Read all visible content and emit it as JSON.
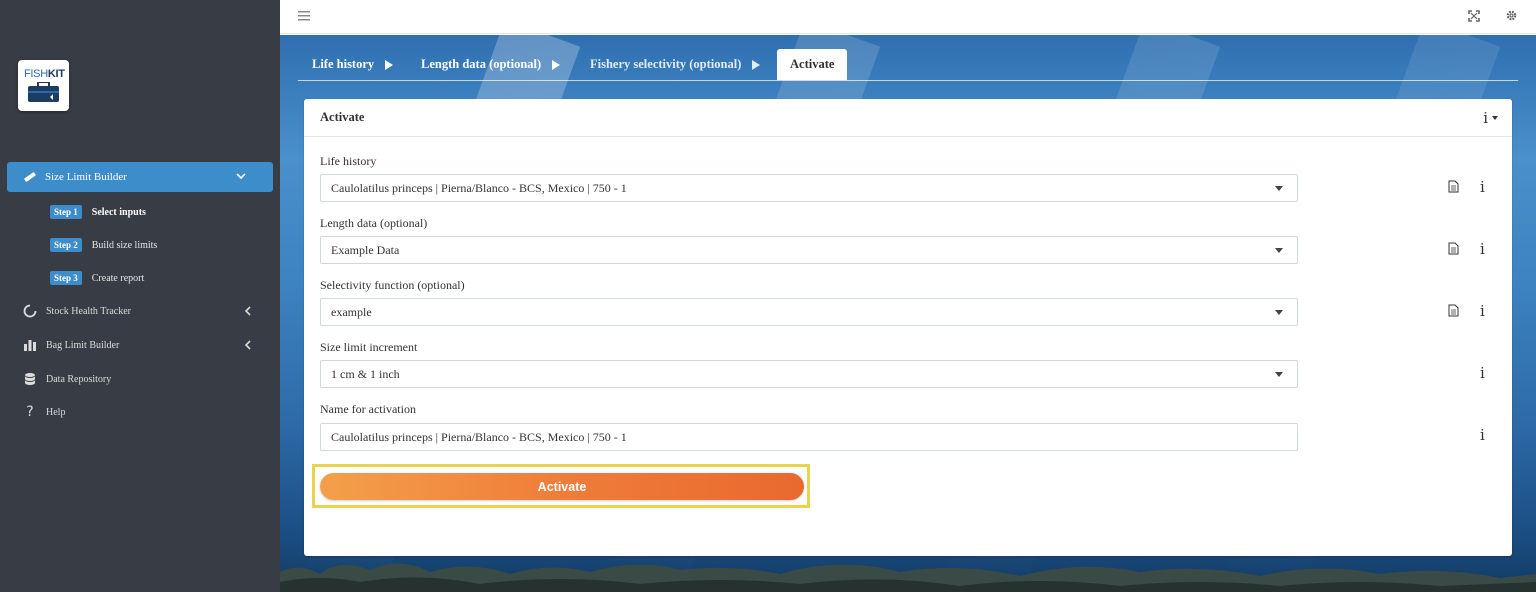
{
  "app": {
    "logo_text_light": "FISH",
    "logo_text_bold": "KIT"
  },
  "sidebar": {
    "active_item": {
      "label": "Size Limit Builder",
      "icon": "ruler-icon"
    },
    "steps": [
      {
        "badge": "Step 1",
        "label": "Select inputs",
        "active": true
      },
      {
        "badge": "Step 2",
        "label": "Build size limits",
        "active": false
      },
      {
        "badge": "Step 3",
        "label": "Create report",
        "active": false
      }
    ],
    "items": [
      {
        "label": "Stock Health Tracker",
        "icon": "circle-notch-icon",
        "has_chevron": true
      },
      {
        "label": "Bag Limit Builder",
        "icon": "bar-chart-icon",
        "has_chevron": true
      },
      {
        "label": "Data Repository",
        "icon": "database-icon",
        "has_chevron": false
      },
      {
        "label": "Help",
        "icon": "question-icon",
        "has_chevron": false
      }
    ]
  },
  "tabs": [
    {
      "label": "Life history",
      "active": false
    },
    {
      "label": "Length data (optional)",
      "active": false
    },
    {
      "label": "Fishery selectivity (optional)",
      "active": false
    },
    {
      "label": "Activate",
      "active": true
    }
  ],
  "card": {
    "title": "Activate",
    "info_glyph": "i",
    "fields": [
      {
        "label": "Life history",
        "value": "Caulolatilus princeps | Pierna/Blanco - BCS, Mexico | 750 - 1",
        "type": "select",
        "doc_icon": true
      },
      {
        "label": "Length data (optional)",
        "value": "Example Data",
        "type": "select",
        "doc_icon": true
      },
      {
        "label": "Selectivity function (optional)",
        "value": "example",
        "type": "select",
        "doc_icon": true
      },
      {
        "label": "Size limit increment",
        "value": "1 cm & 1 inch",
        "type": "select",
        "doc_icon": false
      },
      {
        "label": "Name for activation",
        "value": "Caulolatilus princeps | Pierna/Blanco - BCS, Mexico | 750 - 1",
        "type": "text",
        "doc_icon": false
      }
    ],
    "activate_button": "Activate"
  },
  "colors": {
    "sidebar_bg": "#383c44",
    "accent": "#3c8dca",
    "button_orange": "#ef7d3a",
    "highlight": "#e8d44d"
  }
}
